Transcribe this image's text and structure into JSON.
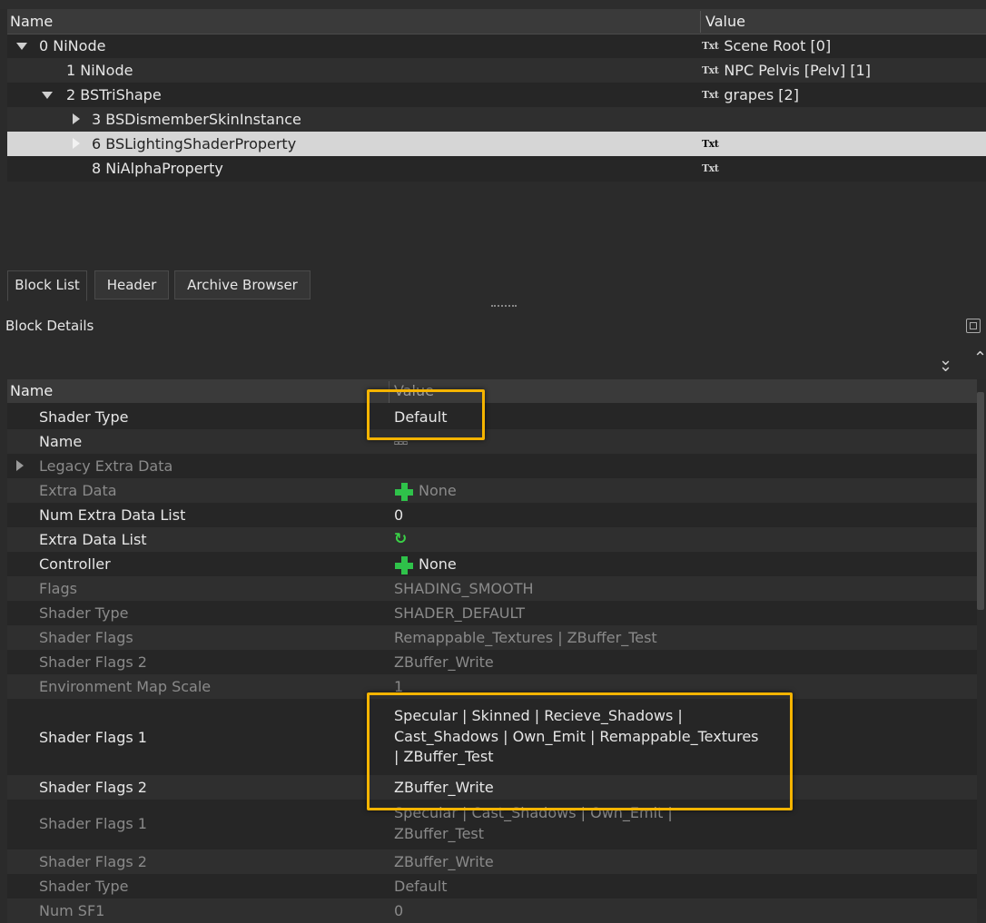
{
  "tree": {
    "columns": {
      "name": "Name",
      "value": "Value"
    },
    "rows": [
      {
        "label": "0 NiNode",
        "value": "Scene Root [0]",
        "icon": "txt-icon",
        "icon_text": "Txt"
      },
      {
        "label": "1 NiNode",
        "value": "NPC Pelvis [Pelv] [1]",
        "icon": "txt-icon",
        "icon_text": "Txt"
      },
      {
        "label": "2 BSTriShape",
        "value": "grapes [2]",
        "icon": "txt-icon",
        "icon_text": "Txt"
      },
      {
        "label": "3 BSDismemberSkinInstance",
        "value": ""
      },
      {
        "label": "6 BSLightingShaderProperty",
        "value": "",
        "icon": "txt-icon",
        "icon_text": "Txt"
      },
      {
        "label": "8 NiAlphaProperty",
        "value": "",
        "icon": "txt-icon",
        "icon_text": "Txt"
      }
    ]
  },
  "tabs": [
    "Block List",
    "Header",
    "Archive Browser"
  ],
  "active_tab": "Block List",
  "details": {
    "title": "Block Details",
    "columns": {
      "name": "Name",
      "value": "Value"
    },
    "rows": [
      {
        "name": "Shader Type",
        "value": "Default"
      },
      {
        "name": "Name",
        "value": ""
      },
      {
        "name": "Legacy Extra Data",
        "value": ""
      },
      {
        "name": "Extra Data",
        "value": "None"
      },
      {
        "name": "Num Extra Data List",
        "value": "0"
      },
      {
        "name": "Extra Data List",
        "value": ""
      },
      {
        "name": "Controller",
        "value": "None"
      },
      {
        "name": "Flags",
        "value": "SHADING_SMOOTH"
      },
      {
        "name": "Shader Type",
        "value": "SHADER_DEFAULT"
      },
      {
        "name": "Shader Flags",
        "value": "Remappable_Textures | ZBuffer_Test"
      },
      {
        "name": "Shader Flags 2",
        "value": "ZBuffer_Write"
      },
      {
        "name": "Environment Map Scale",
        "value": "1"
      },
      {
        "name": "Shader Flags 1",
        "value": "Specular | Skinned | Recieve_Shadows | Cast_Shadows | Own_Emit | Remappable_Textures | ZBuffer_Test"
      },
      {
        "name": "Shader Flags 2",
        "value": "ZBuffer_Write"
      },
      {
        "name": "Shader Flags 1",
        "value": "Specular | Cast_Shadows | Own_Emit | ZBuffer_Test"
      },
      {
        "name": "Shader Flags 2",
        "value": "ZBuffer_Write"
      },
      {
        "name": "Shader Type",
        "value": "Default"
      },
      {
        "name": "Num SF1",
        "value": "0"
      }
    ]
  },
  "colors": {
    "highlight": "#f5b400",
    "selection": "#d6d6d6",
    "add_icon": "#2fc24a"
  }
}
